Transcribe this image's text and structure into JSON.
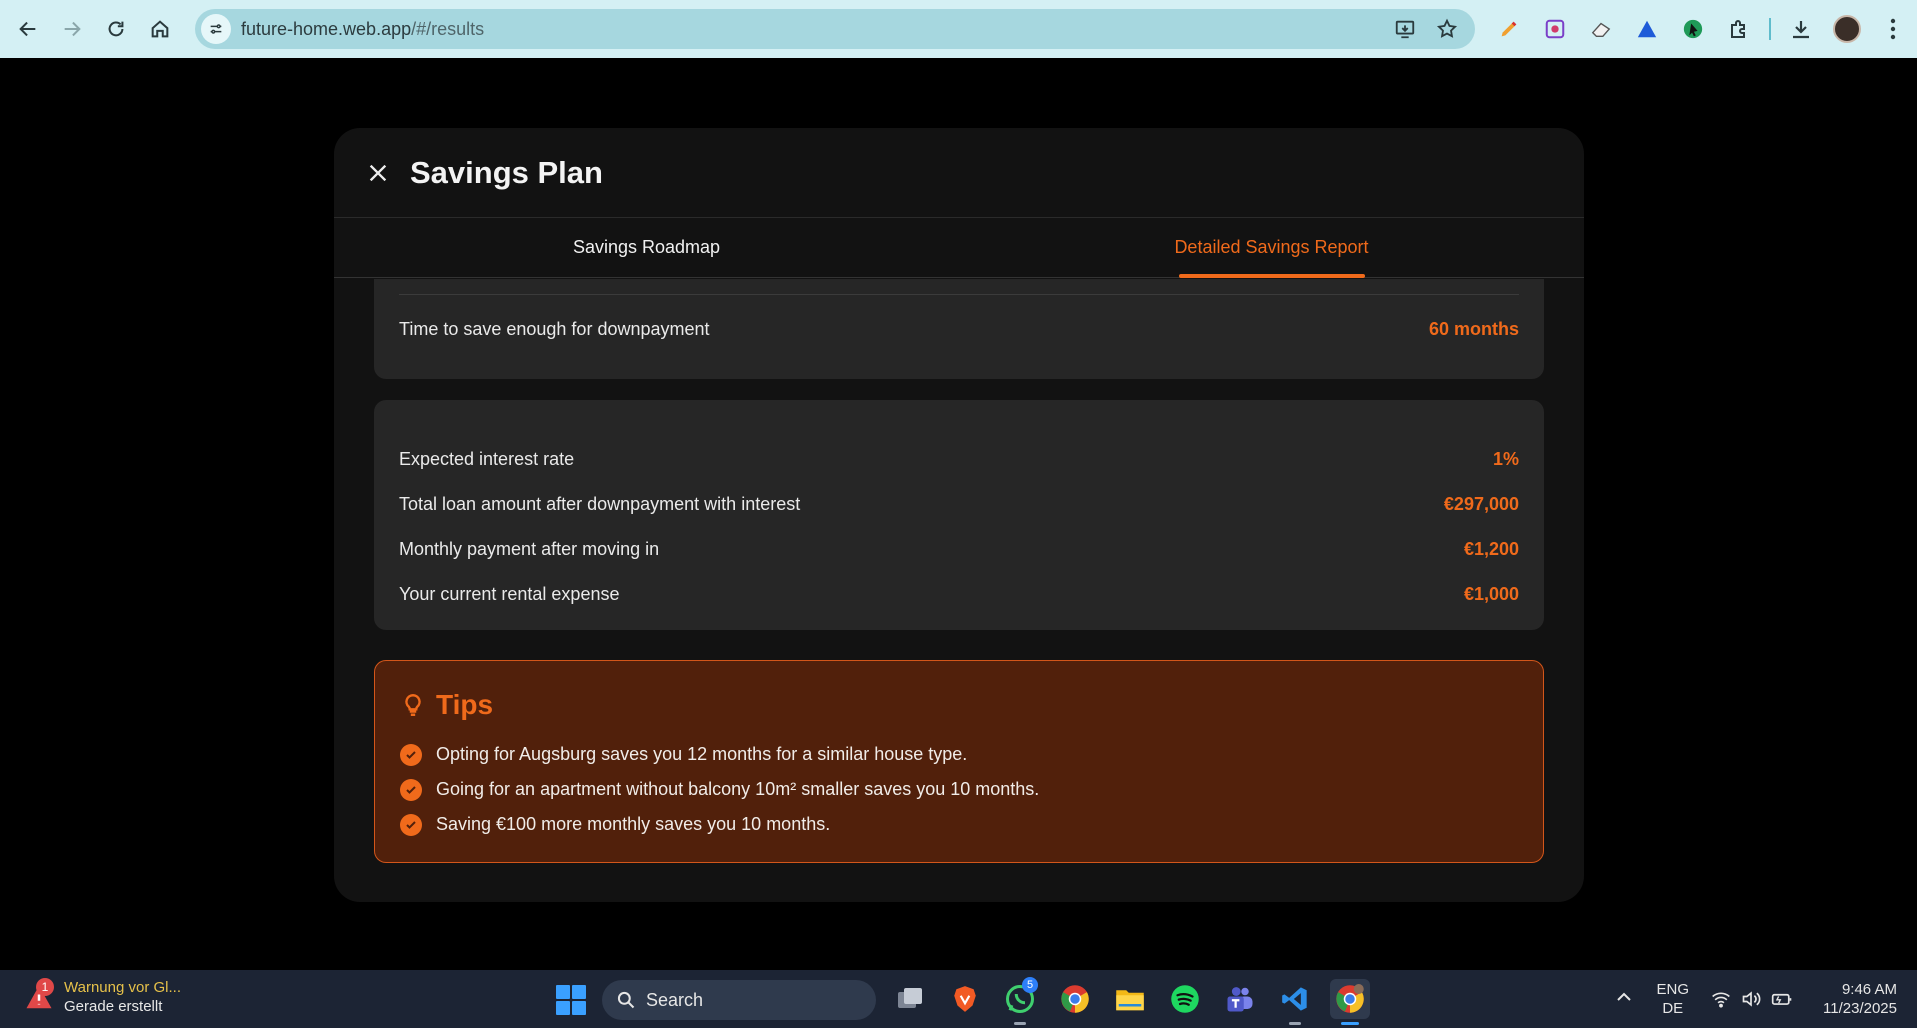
{
  "browser": {
    "url_host": "future-home.web.app",
    "url_path": "/#/results"
  },
  "modal": {
    "title": "Savings Plan",
    "tabs": [
      {
        "label": "Savings Roadmap",
        "active": false
      },
      {
        "label": "Detailed Savings Report",
        "active": true
      }
    ]
  },
  "report": {
    "top": {
      "label": "Time to save enough for downpayment",
      "value": "60 months"
    },
    "rows": [
      {
        "label": "Expected interest rate",
        "value": "1%"
      },
      {
        "label": "Total loan amount after downpayment with interest",
        "value": "€297,000"
      },
      {
        "label": "Monthly payment after moving in",
        "value": "€1,200"
      },
      {
        "label": "Your current rental expense",
        "value": "€1,000"
      }
    ]
  },
  "tips": {
    "title": "Tips",
    "items": [
      "Opting for Augsburg saves you 12 months for a similar house type.",
      "Going for an apartment without balcony 10m² smaller saves you 10 months.",
      "Saving €100 more monthly saves you 10 months."
    ]
  },
  "taskbar": {
    "notification_count": "1",
    "notification_title": "Warnung vor Gl...",
    "notification_sub": "Gerade erstellt",
    "search_label": "Search",
    "whatsapp_badge": "5",
    "lang_top": "ENG",
    "lang_bottom": "DE",
    "time": "9:46 AM",
    "date": "11/23/2025"
  },
  "colors": {
    "accent": "#f06a1b",
    "tips_bg": "#51200b",
    "card_bg": "#262626",
    "modal_bg": "#121212",
    "browser_bar": "#d4f0f4"
  }
}
